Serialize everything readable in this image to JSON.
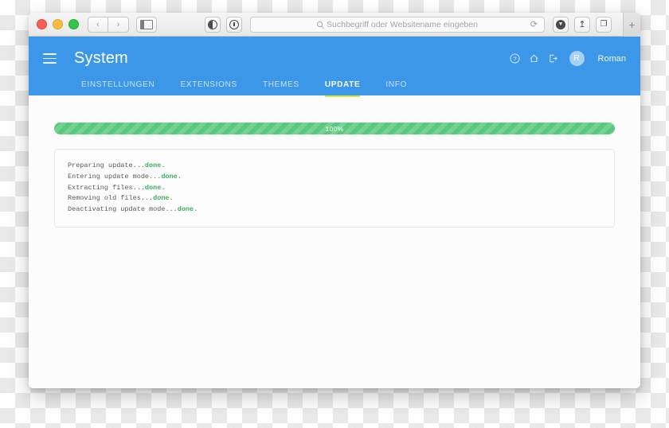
{
  "browser": {
    "traffic_lights": [
      "close",
      "minimize",
      "zoom"
    ],
    "back_label": "‹",
    "forward_label": "›",
    "sidebar_icon": "sidebar-icon",
    "reader_icon": "reader-toggle-icon",
    "info_icon": "info-circle-icon",
    "address": {
      "placeholder": "Suchbegriff oder Websitename eingeben",
      "value": "",
      "reload_label": "⟳"
    },
    "downloads_icon": "downloads-icon",
    "share_label": "↥",
    "tabs_label": "❐",
    "new_tab_label": "+"
  },
  "app": {
    "title": "System",
    "menu_icon": "hamburger-menu-icon",
    "header_color": "#3d97e8",
    "actions": [
      {
        "name": "help-icon",
        "glyph": "?"
      },
      {
        "name": "home-icon",
        "glyph": "⌂"
      },
      {
        "name": "logout-icon",
        "glyph": "↪"
      }
    ],
    "user": {
      "initial": "R",
      "name": "Roman"
    },
    "tabs": [
      {
        "label": "EINSTELLUNGEN",
        "active": false
      },
      {
        "label": "EXTENSIONS",
        "active": false
      },
      {
        "label": "THEMES",
        "active": false
      },
      {
        "label": "UPDATE",
        "active": true
      },
      {
        "label": "INFO",
        "active": false
      }
    ],
    "active_tab_underline_color": "#d7e63c"
  },
  "update": {
    "progress": {
      "percent_label": "100%",
      "value": 100,
      "color": "#57c87c"
    },
    "log": [
      {
        "text": "Preparing update...",
        "status": "done."
      },
      {
        "text": "Entering update mode...",
        "status": "done."
      },
      {
        "text": "Extracting files...",
        "status": "done."
      },
      {
        "text": "Removing old files...",
        "status": "done."
      },
      {
        "text": "Deactivating update mode...",
        "status": "done."
      }
    ],
    "log_status_color": "#3fae5f"
  }
}
